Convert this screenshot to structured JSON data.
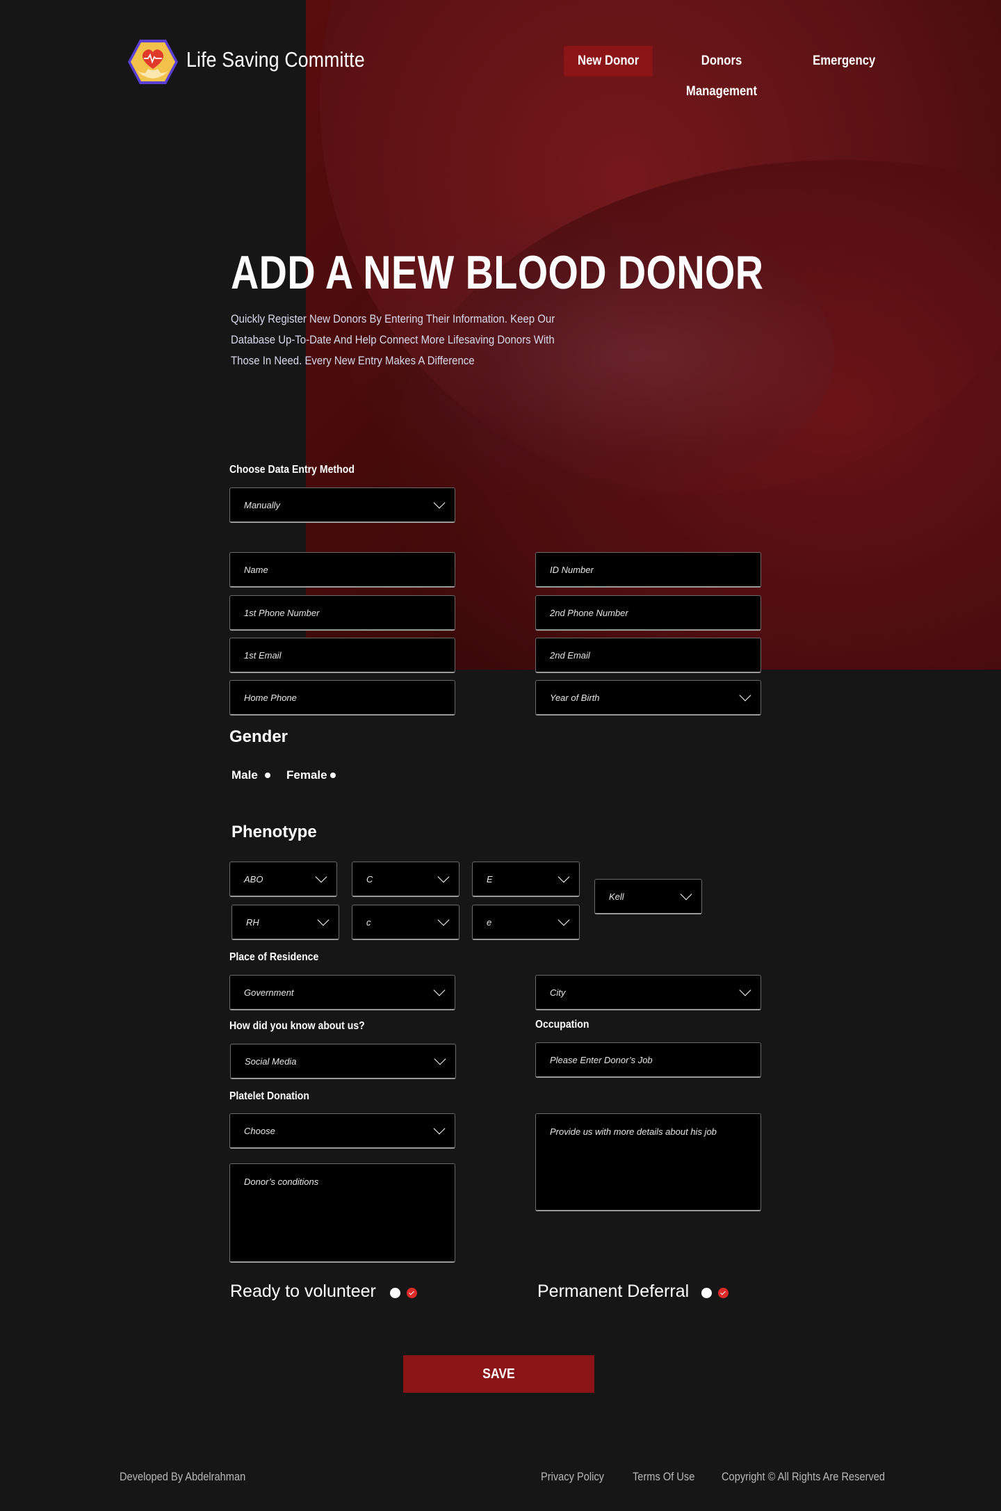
{
  "header": {
    "brand": "Life Saving Committe",
    "nav": {
      "new_donor": "New Donor",
      "donors_management": "Donors Management",
      "emergency": "Emergency"
    },
    "active_nav_color": "#8a1416"
  },
  "hero": {
    "title": "ADD A NEW BLOOD DONOR",
    "description_lines": [
      "Quickly Register New Donors By Entering Their Information. Keep Our",
      "Database Up-To-Date And Help Connect More Lifesaving Donors With",
      "Those In Need. Every New Entry Makes A Difference"
    ]
  },
  "form": {
    "entry_method_label": "Choose Data Entry Method",
    "entry_method_value": "Manually",
    "name_placeholder": "Name",
    "id_placeholder": "ID Number",
    "phone1_placeholder": "1st Phone Number",
    "phone2_placeholder": "2nd Phone Number",
    "email1_placeholder": "1st Email",
    "email2_placeholder": "2nd Email",
    "home_phone_placeholder": "Home Phone",
    "year_of_birth": "Year of Birth",
    "gender_label": "Gender",
    "gender_male": "Male",
    "gender_female": "Female",
    "phenotype_label": "Phenotype",
    "phenotype": {
      "abo": "ABO",
      "c_upper": "C",
      "e_upper": "E",
      "kell": "Kell",
      "rh": "RH",
      "c_lower": "c",
      "e_lower": "e"
    },
    "residence_label": "Place of Residence",
    "government": "Government",
    "city": "City",
    "know_us_label": "How did you know about us?",
    "know_us_value": "Social Media",
    "occupation_label": "Occupation",
    "occupation_placeholder": "Please Enter Donor’s Job",
    "platelet_label": "Platelet Donation",
    "platelet_value": "Choose",
    "job_details_placeholder": "Provide us with more details about his job",
    "conditions_placeholder": "Donor’s conditions",
    "ready_label": "Ready to volunteer",
    "deferral_label": "Permanent Deferral",
    "save_label": "SAVE"
  },
  "footer": {
    "developer": "Developed By Abdelrahman",
    "privacy": "Privacy Policy",
    "terms": "Terms Of Use",
    "copyright": "Copyright © All Rights Are Reserved"
  }
}
